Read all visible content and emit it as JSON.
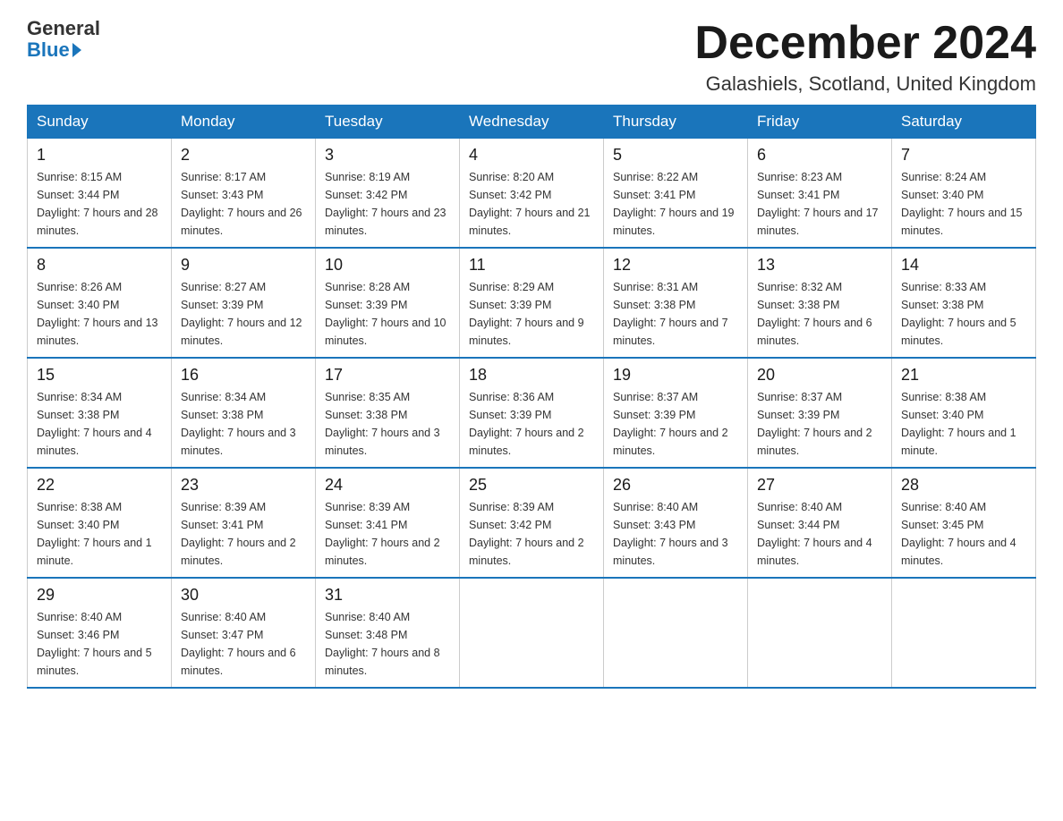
{
  "header": {
    "logo_general": "General",
    "logo_blue": "Blue",
    "month_title": "December 2024",
    "location": "Galashiels, Scotland, United Kingdom"
  },
  "days_of_week": [
    "Sunday",
    "Monday",
    "Tuesday",
    "Wednesday",
    "Thursday",
    "Friday",
    "Saturday"
  ],
  "weeks": [
    [
      {
        "day": "1",
        "sunrise": "8:15 AM",
        "sunset": "3:44 PM",
        "daylight": "7 hours and 28 minutes."
      },
      {
        "day": "2",
        "sunrise": "8:17 AM",
        "sunset": "3:43 PM",
        "daylight": "7 hours and 26 minutes."
      },
      {
        "day": "3",
        "sunrise": "8:19 AM",
        "sunset": "3:42 PM",
        "daylight": "7 hours and 23 minutes."
      },
      {
        "day": "4",
        "sunrise": "8:20 AM",
        "sunset": "3:42 PM",
        "daylight": "7 hours and 21 minutes."
      },
      {
        "day": "5",
        "sunrise": "8:22 AM",
        "sunset": "3:41 PM",
        "daylight": "7 hours and 19 minutes."
      },
      {
        "day": "6",
        "sunrise": "8:23 AM",
        "sunset": "3:41 PM",
        "daylight": "7 hours and 17 minutes."
      },
      {
        "day": "7",
        "sunrise": "8:24 AM",
        "sunset": "3:40 PM",
        "daylight": "7 hours and 15 minutes."
      }
    ],
    [
      {
        "day": "8",
        "sunrise": "8:26 AM",
        "sunset": "3:40 PM",
        "daylight": "7 hours and 13 minutes."
      },
      {
        "day": "9",
        "sunrise": "8:27 AM",
        "sunset": "3:39 PM",
        "daylight": "7 hours and 12 minutes."
      },
      {
        "day": "10",
        "sunrise": "8:28 AM",
        "sunset": "3:39 PM",
        "daylight": "7 hours and 10 minutes."
      },
      {
        "day": "11",
        "sunrise": "8:29 AM",
        "sunset": "3:39 PM",
        "daylight": "7 hours and 9 minutes."
      },
      {
        "day": "12",
        "sunrise": "8:31 AM",
        "sunset": "3:38 PM",
        "daylight": "7 hours and 7 minutes."
      },
      {
        "day": "13",
        "sunrise": "8:32 AM",
        "sunset": "3:38 PM",
        "daylight": "7 hours and 6 minutes."
      },
      {
        "day": "14",
        "sunrise": "8:33 AM",
        "sunset": "3:38 PM",
        "daylight": "7 hours and 5 minutes."
      }
    ],
    [
      {
        "day": "15",
        "sunrise": "8:34 AM",
        "sunset": "3:38 PM",
        "daylight": "7 hours and 4 minutes."
      },
      {
        "day": "16",
        "sunrise": "8:34 AM",
        "sunset": "3:38 PM",
        "daylight": "7 hours and 3 minutes."
      },
      {
        "day": "17",
        "sunrise": "8:35 AM",
        "sunset": "3:38 PM",
        "daylight": "7 hours and 3 minutes."
      },
      {
        "day": "18",
        "sunrise": "8:36 AM",
        "sunset": "3:39 PM",
        "daylight": "7 hours and 2 minutes."
      },
      {
        "day": "19",
        "sunrise": "8:37 AM",
        "sunset": "3:39 PM",
        "daylight": "7 hours and 2 minutes."
      },
      {
        "day": "20",
        "sunrise": "8:37 AM",
        "sunset": "3:39 PM",
        "daylight": "7 hours and 2 minutes."
      },
      {
        "day": "21",
        "sunrise": "8:38 AM",
        "sunset": "3:40 PM",
        "daylight": "7 hours and 1 minute."
      }
    ],
    [
      {
        "day": "22",
        "sunrise": "8:38 AM",
        "sunset": "3:40 PM",
        "daylight": "7 hours and 1 minute."
      },
      {
        "day": "23",
        "sunrise": "8:39 AM",
        "sunset": "3:41 PM",
        "daylight": "7 hours and 2 minutes."
      },
      {
        "day": "24",
        "sunrise": "8:39 AM",
        "sunset": "3:41 PM",
        "daylight": "7 hours and 2 minutes."
      },
      {
        "day": "25",
        "sunrise": "8:39 AM",
        "sunset": "3:42 PM",
        "daylight": "7 hours and 2 minutes."
      },
      {
        "day": "26",
        "sunrise": "8:40 AM",
        "sunset": "3:43 PM",
        "daylight": "7 hours and 3 minutes."
      },
      {
        "day": "27",
        "sunrise": "8:40 AM",
        "sunset": "3:44 PM",
        "daylight": "7 hours and 4 minutes."
      },
      {
        "day": "28",
        "sunrise": "8:40 AM",
        "sunset": "3:45 PM",
        "daylight": "7 hours and 4 minutes."
      }
    ],
    [
      {
        "day": "29",
        "sunrise": "8:40 AM",
        "sunset": "3:46 PM",
        "daylight": "7 hours and 5 minutes."
      },
      {
        "day": "30",
        "sunrise": "8:40 AM",
        "sunset": "3:47 PM",
        "daylight": "7 hours and 6 minutes."
      },
      {
        "day": "31",
        "sunrise": "8:40 AM",
        "sunset": "3:48 PM",
        "daylight": "7 hours and 8 minutes."
      },
      null,
      null,
      null,
      null
    ]
  ]
}
